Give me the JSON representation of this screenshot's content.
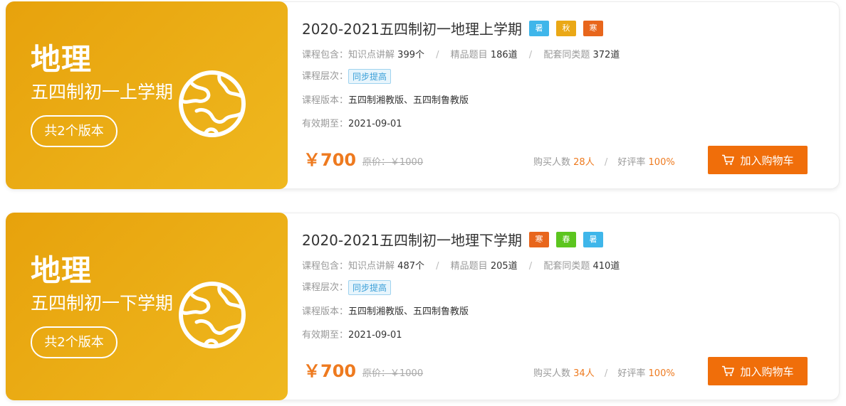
{
  "courses": [
    {
      "subject": "地理",
      "term": "五四制初一上学期",
      "versions_label": "共2个版本",
      "title": "2020-2021五四制初一地理上学期",
      "seasons": [
        {
          "label": "暑",
          "color": "#3fb6ea"
        },
        {
          "label": "秋",
          "color": "#eaa816"
        },
        {
          "label": "寒",
          "color": "#e8661c"
        }
      ],
      "contains_label": "课程包含：",
      "knowledge_label": "知识点讲解",
      "knowledge_value": "399个",
      "questions_label": "精品题目",
      "questions_value": "186道",
      "similar_label": "配套同类题",
      "similar_value": "372道",
      "level_label": "课程层次：",
      "level_value": "同步提高",
      "version_label": "课程版本：",
      "version_value": "五四制湘教版、五四制鲁教版",
      "expire_label": "有效期至：",
      "expire_value": "2021-09-01",
      "price": "￥700",
      "original_price": "原价：￥1000",
      "buyers_label": "购买人数",
      "buyers_value": "28人",
      "rating_label": "好评率",
      "rating_value": "100%",
      "cart_label": "加入购物车",
      "icons": {
        "banner": "globe-icon",
        "cart": "cart-icon"
      }
    },
    {
      "subject": "地理",
      "term": "五四制初一下学期",
      "versions_label": "共2个版本",
      "title": "2020-2021五四制初一地理下学期",
      "seasons": [
        {
          "label": "寒",
          "color": "#e8661c"
        },
        {
          "label": "春",
          "color": "#5cc51f"
        },
        {
          "label": "暑",
          "color": "#3fb6ea"
        }
      ],
      "contains_label": "课程包含：",
      "knowledge_label": "知识点讲解",
      "knowledge_value": "487个",
      "questions_label": "精品题目",
      "questions_value": "205道",
      "similar_label": "配套同类题",
      "similar_value": "410道",
      "level_label": "课程层次：",
      "level_value": "同步提高",
      "version_label": "课程版本：",
      "version_value": "五四制湘教版、五四制鲁教版",
      "expire_label": "有效期至：",
      "expire_value": "2021-09-01",
      "price": "￥700",
      "original_price": "原价：￥1000",
      "buyers_label": "购买人数",
      "buyers_value": "34人",
      "rating_label": "好评率",
      "rating_value": "100%",
      "cart_label": "加入购物车",
      "icons": {
        "banner": "globe-icon",
        "cart": "cart-icon"
      }
    }
  ]
}
